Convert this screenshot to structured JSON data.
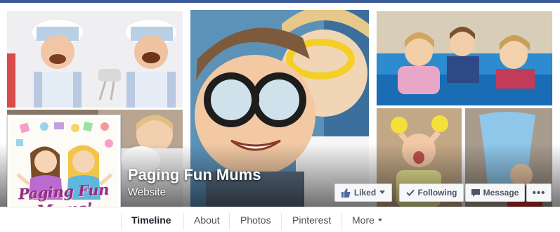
{
  "page": {
    "name": "Paging Fun Mums",
    "category": "Website",
    "logo_text": "Paging Fun Mums!"
  },
  "actions": {
    "liked_label": "Liked",
    "following_label": "Following",
    "message_label": "Message",
    "more_label": "•••"
  },
  "nav": {
    "timeline": "Timeline",
    "about": "About",
    "photos": "Photos",
    "pinterest": "Pinterest",
    "more": "More"
  },
  "colors": {
    "facebook_blue": "#3b5998",
    "button_bg": "#f6f7f9",
    "logo_purple": "#8e2f7f"
  }
}
